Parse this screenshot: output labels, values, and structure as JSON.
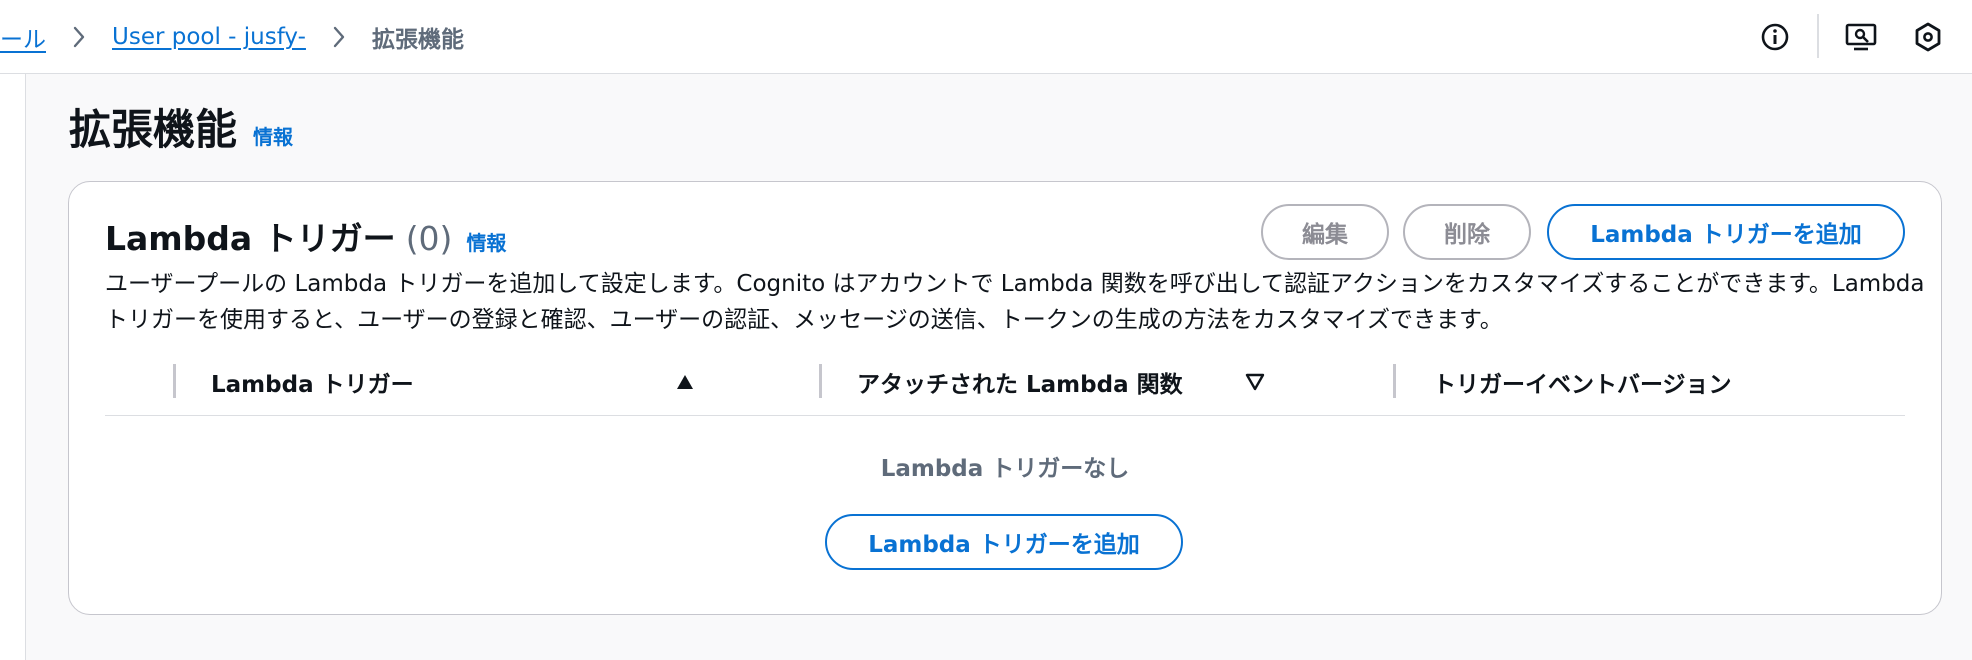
{
  "breadcrumb": {
    "items": [
      {
        "label": "ール"
      },
      {
        "label": "User pool - jusfy-"
      }
    ],
    "current": "拡張機能"
  },
  "utility_icons": [
    "info-icon",
    "monitor-feedback-icon",
    "settings-hex-icon"
  ],
  "page": {
    "title": "拡張機能",
    "info": "情報"
  },
  "card": {
    "title": "Lambda トリガー",
    "count": "(0)",
    "info": "情報",
    "buttons": {
      "edit": "編集",
      "delete": "削除",
      "add": "Lambda トリガーを追加"
    },
    "description": "ユーザープールの Lambda トリガーを追加して設定します。Cognito はアカウントで Lambda 関数を呼び出して認証アクションをカスタマイズすることができます。Lambda トリガーを使用すると、ユーザーの登録と確認、ユーザーの認証、メッセージの送信、トークンの生成の方法をカスタマイズできます。",
    "table": {
      "columns": [
        "Lambda トリガー",
        "アタッチされた Lambda 関数",
        "トリガーイベントバージョン"
      ],
      "empty_text": "Lambda トリガーなし",
      "empty_add_button": "Lambda トリガーを追加"
    }
  },
  "colors": {
    "link": "#0972d3",
    "text": "#0f141a",
    "muted": "#5f6b7a",
    "disabled_border": "#b4b4bb",
    "background": "#f9f9fa"
  }
}
